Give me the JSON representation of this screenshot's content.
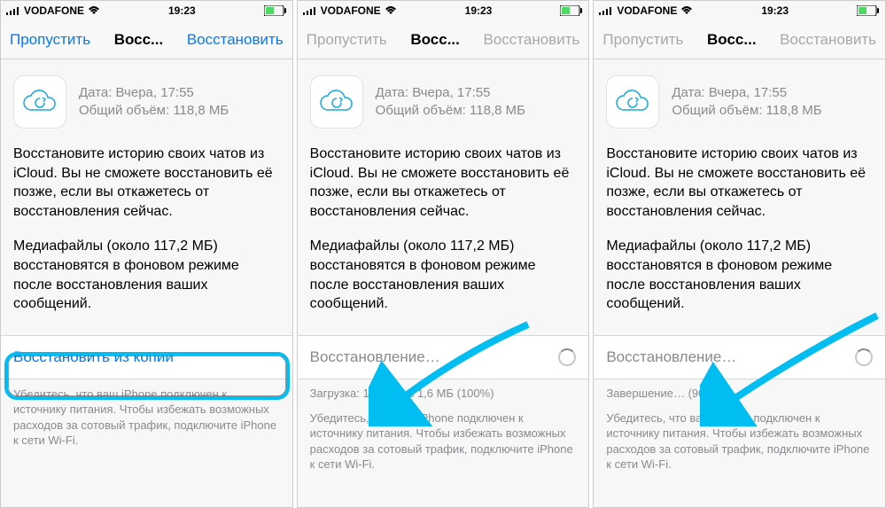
{
  "status": {
    "carrier": "VODAFONE",
    "time": "19:23",
    "wifi": true
  },
  "screens": [
    {
      "nav": {
        "left": "Пропустить",
        "title": "Восс...",
        "right": "Восстановить",
        "disabled": false
      },
      "info": {
        "date": "Дата: Вчера, 17:55",
        "size": "Общий объём: 118,8 МБ"
      },
      "desc1": "Восстановите историю своих чатов из iCloud. Вы не сможете восстановить её позже, если вы откажетесь от восстановления сейчас.",
      "desc2": "Медиафайлы (около 117,2 МБ) восстановятся в фоновом режиме после восстановления ваших сообщений.",
      "restore": {
        "label": "Восстановить из копии",
        "isProgress": false
      },
      "progressText": "",
      "footer": "Убедитесь, что ваш iPhone подключен к источнику питания. Чтобы избежать возможных расходов за сотовый трафик, подключите iPhone к сети Wi-Fi."
    },
    {
      "nav": {
        "left": "Пропустить",
        "title": "Восс...",
        "right": "Восстановить",
        "disabled": true
      },
      "info": {
        "date": "Дата: Вчера, 17:55",
        "size": "Общий объём: 118,8 МБ"
      },
      "desc1": "Восстановите историю своих чатов из iCloud. Вы не сможете восстановить её позже, если вы откажетесь от восстановления сейчас.",
      "desc2": "Медиафайлы (около 117,2 МБ) восстановятся в фоновом режиме после восстановления ваших сообщений.",
      "restore": {
        "label": "Восстановление…",
        "isProgress": true
      },
      "progressText": "Загрузка: 1,6 МБ из 1,6 МБ (100%)",
      "footer": "Убедитесь, что ваш iPhone подключен к источнику питания. Чтобы избежать возможных расходов за сотовый трафик, подключите iPhone к сети Wi-Fi."
    },
    {
      "nav": {
        "left": "Пропустить",
        "title": "Восс...",
        "right": "Восстановить",
        "disabled": true
      },
      "info": {
        "date": "Дата: Вчера, 17:55",
        "size": "Общий объём: 118,8 МБ"
      },
      "desc1": "Восстановите историю своих чатов из iCloud. Вы не сможете восстановить её позже, если вы откажетесь от восстановления сейчас.",
      "desc2": "Медиафайлы (около 117,2 МБ) восстановятся в фоновом режиме после восстановления ваших сообщений.",
      "restore": {
        "label": "Восстановление…",
        "isProgress": true
      },
      "progressText": "Завершение… (90%)",
      "footer": "Убедитесь, что ваш iPhone подключен к источнику питания. Чтобы избежать возможных расходов за сотовый трафик, подключите iPhone к сети Wi-Fi."
    }
  ],
  "colors": {
    "link": "#007aff",
    "muted": "#8a8a8e",
    "annot": "#00bdf2"
  }
}
